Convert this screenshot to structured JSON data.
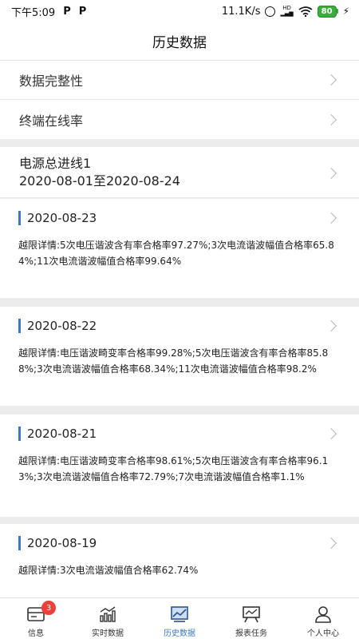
{
  "status_bar": {
    "time": "下午5:09",
    "notif_icons": [
      "P",
      "P"
    ],
    "speed": "11.1K/s",
    "battery": "80"
  },
  "header": {
    "title": "历史数据"
  },
  "menu": [
    {
      "label": "数据完整性"
    },
    {
      "label": "终端在线率"
    }
  ],
  "source": {
    "name": "电源总进线1",
    "range": "2020-08-01至2020-08-24"
  },
  "records": [
    {
      "date": "2020-08-23",
      "detail": "越限详情:5次电压谐波含有率合格率97.27%;3次电流谐波幅值合格率65.84%;11次电流谐波幅值合格率99.64%"
    },
    {
      "date": "2020-08-22",
      "detail": "越限详情:电压谐波畸变率合格率99.28%;5次电压谐波含有率合格率85.88%;3次电流谐波幅值合格率68.34%;11次电流谐波幅值合格率98.2%"
    },
    {
      "date": "2020-08-21",
      "detail": "越限详情:电压谐波畸变率合格率98.61%;5次电压谐波含有率合格率96.13%;3次电流谐波幅值合格率72.79%;7次电流谐波幅值合格率1.1%"
    },
    {
      "date": "2020-08-19",
      "detail": "越限详情:3次电流谐波幅值合格率62.74%"
    }
  ],
  "tabbar": {
    "tabs": [
      {
        "label": "信息",
        "icon": "info-icon",
        "badge": "3"
      },
      {
        "label": "实时数据",
        "icon": "bar-chart-icon"
      },
      {
        "label": "历史数据",
        "icon": "history-chart-icon",
        "active": true
      },
      {
        "label": "报表任务",
        "icon": "report-board-icon"
      },
      {
        "label": "个人中心",
        "icon": "person-icon"
      }
    ],
    "accent_color": "#3a78c3"
  }
}
